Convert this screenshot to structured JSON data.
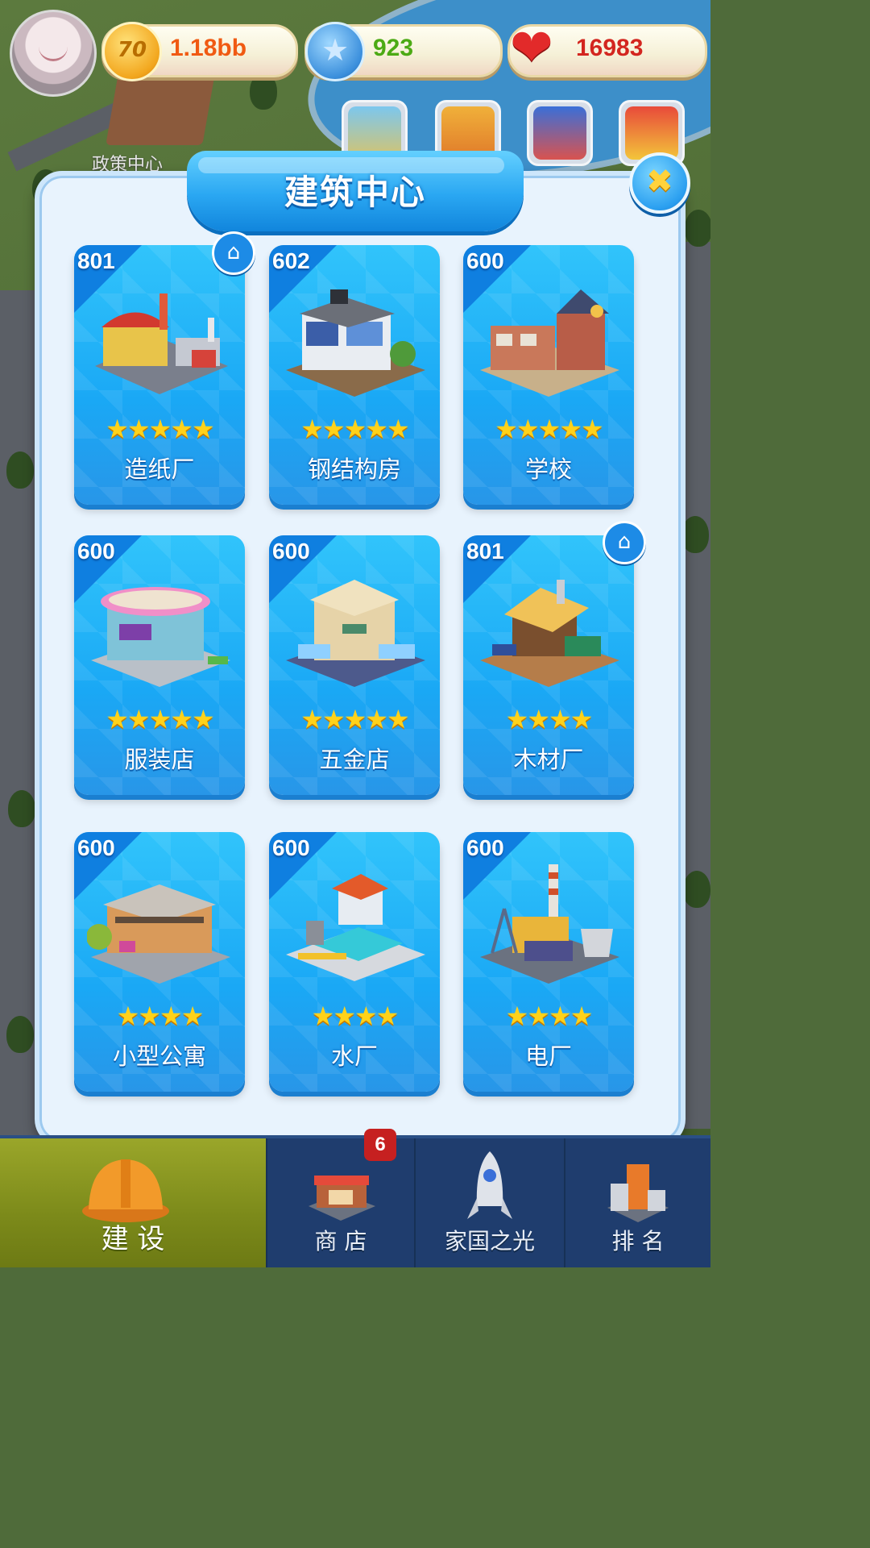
{
  "top_bar": {
    "coins": "1.18bb",
    "coin_icon_text": "70",
    "stars": "923",
    "hearts": "16983"
  },
  "map_label": "政策中心",
  "dialog": {
    "title": "建筑中心",
    "close_symbol": "✖"
  },
  "cards": [
    {
      "level": "801",
      "stars": "★★★★★",
      "name": "造纸厂"
    },
    {
      "level": "602",
      "stars": "★★★★★",
      "name": "钢结构房"
    },
    {
      "level": "600",
      "stars": "★★★★★",
      "name": "学校"
    },
    {
      "level": "600",
      "stars": "★★★★★",
      "name": "服装店"
    },
    {
      "level": "600",
      "stars": "★★★★★",
      "name": "五金店"
    },
    {
      "level": "801",
      "stars": "★★★★",
      "name": "木材厂"
    },
    {
      "level": "600",
      "stars": "★★★★",
      "name": "小型公寓"
    },
    {
      "level": "600",
      "stars": "★★★★",
      "name": "水厂"
    },
    {
      "level": "600",
      "stars": "★★★★",
      "name": "电厂"
    }
  ],
  "nav": {
    "build": "建 设",
    "shop": "商 店",
    "shop_badge": "6",
    "homeland": "家国之光",
    "rank": "排 名"
  },
  "icons": {
    "coin": "coin-icon",
    "star": "star-gem-icon",
    "heart": "heart-icon",
    "home": "home-icon",
    "close": "close-icon"
  }
}
